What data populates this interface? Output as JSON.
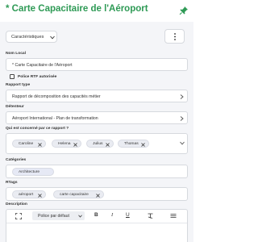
{
  "header": {
    "title": "* Carte Capacitaire de l'Aéroport"
  },
  "toolbar": {
    "tabs_select_label": "Caractéristiques"
  },
  "fields": {
    "nom_local": {
      "label": "Nom Local",
      "value": "* Carte Capacitaire de l'Aéroport"
    },
    "police_rtf": {
      "label": "Police RTF autorisée",
      "checked": false
    },
    "rapport_type": {
      "label": "Rapport type",
      "value": "Rapport de décomposition des capacités métier"
    },
    "detenteur": {
      "label": "Détenteur",
      "value": "Aéroport International - Plan de transformation"
    },
    "concerne": {
      "label": "Qui est concerné par ce rapport ?",
      "chips": [
        "Caroline",
        "Helena",
        "Julius",
        "Thomas"
      ]
    },
    "categories": {
      "label": "Catégories",
      "chips": [
        "Architecture"
      ]
    },
    "rtags": {
      "label": "RTags",
      "chips": [
        "aéroport",
        "carte capacitaire"
      ]
    },
    "description": {
      "label": "Description",
      "font_select": "Police par défaut",
      "buttons": [
        "B",
        "I",
        "U"
      ]
    }
  },
  "colors": {
    "title": "#2e9a55",
    "background": "#f4f5f8"
  }
}
